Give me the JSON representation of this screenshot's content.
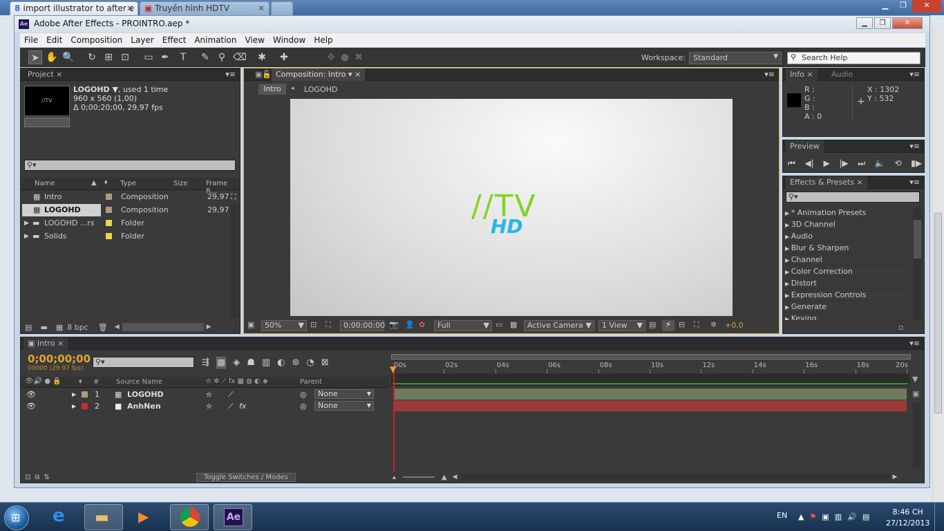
{
  "browser": {
    "tabs": [
      {
        "label": "import illustrator to after e"
      },
      {
        "label": "Truyền hình HDTV"
      }
    ]
  },
  "window": {
    "title": "Adobe After Effects - PROINTRO.aep *",
    "app_icon": "Ae"
  },
  "menu": [
    "File",
    "Edit",
    "Composition",
    "Layer",
    "Effect",
    "Animation",
    "View",
    "Window",
    "Help"
  ],
  "toolbar": {
    "workspace_label": "Workspace:",
    "workspace_value": "Standard",
    "search_placeholder": "Search Help"
  },
  "project": {
    "tab": "Project",
    "item_name": "LOGOHD ▼",
    "item_used": ", used 1 time",
    "item_dims": "960 x 560 (1,00)",
    "item_duration": "Δ 0;00;20;00, 29,97 fps",
    "bpc": "8 bpc",
    "columns": {
      "name": "Name",
      "type": "Type",
      "size": "Size",
      "frame_rate": "Frame R..."
    },
    "rows": [
      {
        "name": "Intro",
        "type": "Composition",
        "rate": "29,97",
        "color": "#b19a7c"
      },
      {
        "name": "LOGOHD",
        "type": "Composition",
        "rate": "29,97",
        "color": "#b19a7c"
      },
      {
        "name": "LOGOHD ...rs",
        "type": "Folder",
        "rate": "",
        "color": "#e8d54a"
      },
      {
        "name": "Solids",
        "type": "Folder",
        "rate": "",
        "color": "#e8d54a"
      }
    ]
  },
  "composition": {
    "tab": "Composition: Intro",
    "crumb_active": "Intro",
    "crumb_next": "LOGOHD",
    "logo_top": "//TV",
    "logo_bottom": "HD",
    "viewer": {
      "zoom": "50%",
      "timecode": "0;00;00;00",
      "resolution": "Full",
      "camera": "Active Camera",
      "views": "1 View",
      "exposure": "+0,0"
    }
  },
  "info": {
    "tab": "Info",
    "tab2": "Audio",
    "r": "R :",
    "g": "G :",
    "b": "B :",
    "a": "A : 0",
    "x": "X : 1302",
    "y": "Y : 532"
  },
  "preview": {
    "tab": "Preview"
  },
  "effects": {
    "tab": "Effects & Presets",
    "items": [
      "* Animation Presets",
      "3D Channel",
      "Audio",
      "Blur & Sharpen",
      "Channel",
      "Color Correction",
      "Distort",
      "Expression Controls",
      "Generate",
      "Keying"
    ]
  },
  "timeline": {
    "tab": "Intro",
    "timecode": "0;00;00;00",
    "frame_info": "00000 (29.97 fps)",
    "col_source": "Source Name",
    "col_num": "#",
    "col_parent": "Parent",
    "toggle": "Toggle Switches / Modes",
    "ticks": [
      "00s",
      "02s",
      "04s",
      "06s",
      "08s",
      "10s",
      "12s",
      "14s",
      "16s",
      "18s",
      "20s"
    ],
    "layers": [
      {
        "num": "1",
        "name": "LOGOHD",
        "parent": "None",
        "label": "#b19a7c",
        "bar": "#6f7a5e"
      },
      {
        "num": "2",
        "name": "AnhNen",
        "parent": "None",
        "label": "#c03030",
        "bar": "#9a3a3a"
      }
    ]
  },
  "taskbar": {
    "lang": "EN",
    "time": "8:46 CH",
    "date": "27/12/2013",
    "ae_label": "Ae"
  }
}
